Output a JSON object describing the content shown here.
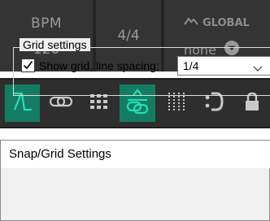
{
  "transport": {
    "bpm_label": "BPM",
    "bpm_value": "120",
    "time_signature": "4/4",
    "global_label": "GLOBAL",
    "global_value": "none"
  },
  "snap_toolbar": {
    "buttons": [
      {
        "name": "snap-toggle",
        "icon": "snap-x-icon",
        "active": true
      },
      {
        "name": "link",
        "icon": "link-icon",
        "active": false
      },
      {
        "name": "grid-dots",
        "icon": "grid-dots-icon",
        "active": false
      },
      {
        "name": "snap-to-items",
        "icon": "snap-items-icon",
        "active": true
      },
      {
        "name": "grid-lines",
        "icon": "grid-lines-icon",
        "active": false
      },
      {
        "name": "loop-snap",
        "icon": "loop-snap-icon",
        "active": false
      },
      {
        "name": "lock",
        "icon": "lock-icon",
        "active": false
      }
    ],
    "colors": {
      "active_bg": "#157c64",
      "active_icon": "#22e0b0",
      "idle_icon": "#c8c8c8"
    }
  },
  "dialog": {
    "title": "Snap/Grid Settings",
    "group_label": "Grid settings",
    "show_grid_label": "Show grid, line spacing:",
    "show_grid_checked": true,
    "line_spacing_value": "1/4"
  }
}
